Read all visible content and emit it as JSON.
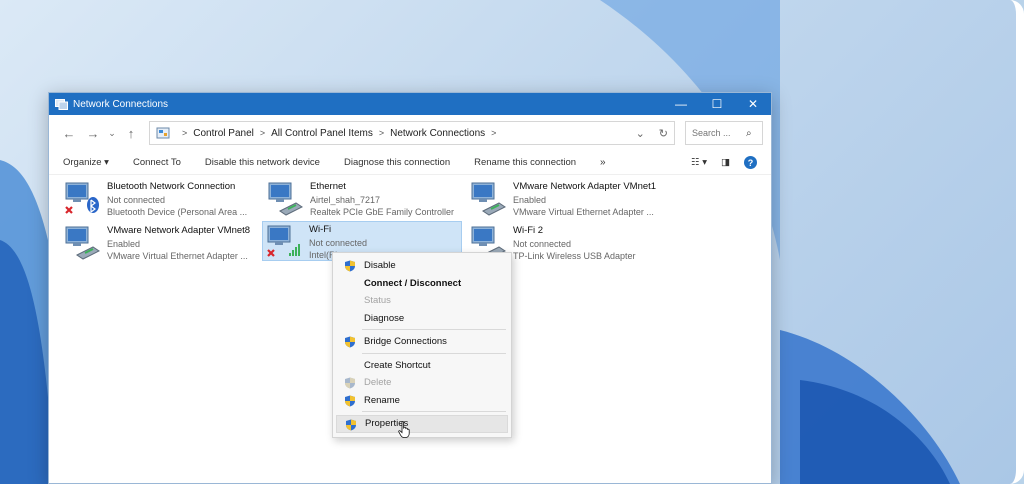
{
  "window": {
    "title": "Network Connections",
    "controls": {
      "minimize": "—",
      "maximize": "☐",
      "close": "✕"
    }
  },
  "nav": {
    "back": "←",
    "forward": "→",
    "recent": "⌄",
    "up": "↑"
  },
  "address": {
    "path": [
      "Control Panel",
      "All Control Panel Items",
      "Network Connections"
    ],
    "separator": ">",
    "dropdown": "⌄",
    "refresh": "↻"
  },
  "search": {
    "placeholder": "Search ..."
  },
  "toolbar": {
    "organize": "Organize ▾",
    "connect_to": "Connect To",
    "disable": "Disable this network device",
    "diagnose": "Diagnose this connection",
    "rename": "Rename this connection",
    "more": "»",
    "view": "☷ ▾",
    "pane": "◨",
    "help": "?"
  },
  "adapters": [
    {
      "name": "Bluetooth Network Connection",
      "status": "Not connected",
      "device": "Bluetooth Device (Personal Area ...",
      "icon": "bluetooth-adapter-icon"
    },
    {
      "name": "Ethernet",
      "status": "Airtel_shah_7217",
      "device": "Realtek PCIe GbE Family Controller",
      "icon": "ethernet-adapter-icon"
    },
    {
      "name": "VMware Network Adapter VMnet1",
      "status": "Enabled",
      "device": "VMware Virtual Ethernet Adapter ...",
      "icon": "vmware-adapter-icon"
    },
    {
      "name": "VMware Network Adapter VMnet8",
      "status": "Enabled",
      "device": "VMware Virtual Ethernet Adapter ...",
      "icon": "vmware-adapter-icon"
    },
    {
      "name": "Wi-Fi",
      "status": "Not connected",
      "device": "Intel(R)",
      "icon": "wifi-adapter-icon"
    },
    {
      "name": "Wi-Fi 2",
      "status": "Not connected",
      "device": "TP-Link Wireless USB Adapter",
      "icon": "wifi-adapter-icon"
    }
  ],
  "context_menu": {
    "disable": "Disable",
    "connect": "Connect / Disconnect",
    "status": "Status",
    "diagnose": "Diagnose",
    "bridge": "Bridge Connections",
    "shortcut": "Create Shortcut",
    "delete": "Delete",
    "rename": "Rename",
    "properties": "Properties"
  },
  "colors": {
    "titlebar": "#1f6fc2",
    "selection": "#cfe4f7",
    "error": "#d8262c"
  }
}
